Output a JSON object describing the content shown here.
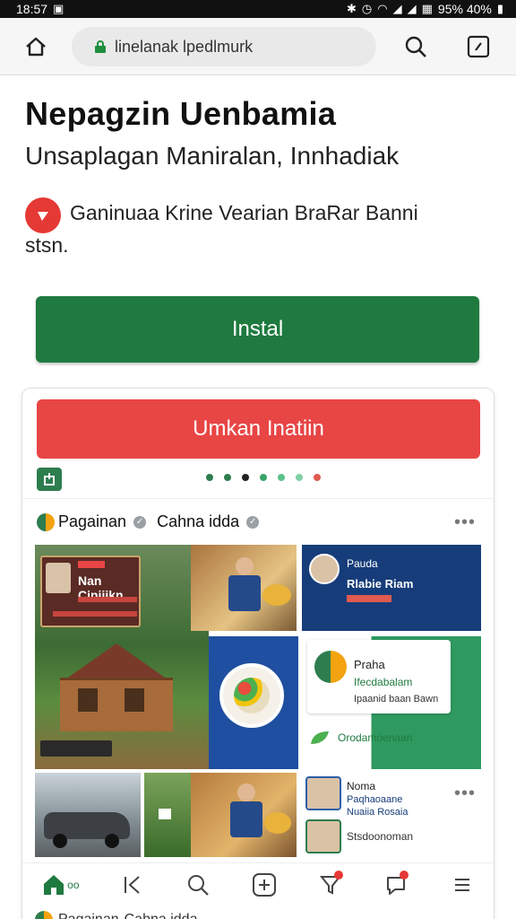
{
  "status_bar": {
    "time": "18:57",
    "battery_text": "95% 40%"
  },
  "browser": {
    "url": "linelanak lpedlmurk",
    "icons": [
      "home-icon",
      "lock-icon",
      "search-icon",
      "edit-icon"
    ]
  },
  "app": {
    "title": "Nepagzin Uenbamia",
    "subtitle": "Unsaplagan Maniralan, Innhadiak",
    "promo_line1": "Ganinuaa Krine Vearian BraRar Banni",
    "promo_line2": "stsn.",
    "install_label": "Instal",
    "secondary_button_label": "Umkan Inatiin"
  },
  "carousel": {
    "dot_colors": [
      "#2e7d4f",
      "#2e7d4f",
      "#222222",
      "#3aa36a",
      "#5cc189",
      "#7fd0a5",
      "#e05a4f"
    ]
  },
  "feed": {
    "author": "Pagainan",
    "channel": "Cahna idda",
    "more_label": "•••",
    "tiles": {
      "house_banner_title": "Nan Ciniiikn",
      "blue_card_line1": "Pauda",
      "blue_card_line2": "Rlabie Riam",
      "green_card_title": "Praha",
      "green_card_line1": "Ifecdabalam",
      "green_card_line2": "Ipaanid baan Bawn",
      "green_card_footer": "Orodamoenaan",
      "side_item1_title": "Noma",
      "side_item1_line1": "Paqhaoaane",
      "side_item1_line2": "Nuaiia Rosaia",
      "side_item2_title": "Stsdoonoman"
    },
    "peek_author": "Pagainan",
    "peek_channel": "Cahna idda"
  },
  "tabbar": {
    "icons": [
      "home-icon",
      "back-icon",
      "search-icon",
      "add-icon",
      "filter-icon",
      "chat-icon",
      "menu-icon"
    ],
    "home_label": "oo"
  },
  "colors": {
    "install_green": "#1f7a3f",
    "secondary_red": "#e84545",
    "promo_red": "#e53935",
    "brand_green": "#2e7d4f",
    "brand_blue": "#163d7a"
  }
}
